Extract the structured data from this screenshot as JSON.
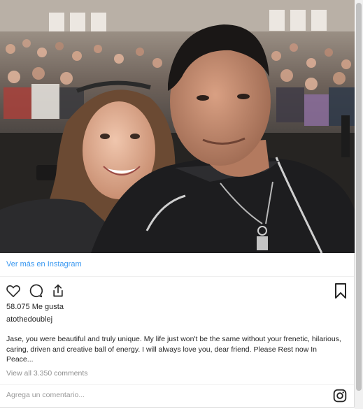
{
  "post": {
    "view_more_link": "Ver más en Instagram",
    "likes": "58.075 Me gusta",
    "username": "atothedoublej",
    "caption": "Jase, you were beautiful and truly unique. My life just won't be the same without your frenetic, hilarious, caring, driven and creative ball of energy. I will always love you, dear friend. Please Rest now In Peace...",
    "view_all_comments": "View all 3.350 comments",
    "comment_placeholder": "Agrega un comentario..."
  },
  "icons": {
    "like": "heart-icon",
    "comment": "comment-bubble-icon",
    "share": "share-icon",
    "save": "bookmark-icon",
    "brand": "instagram-icon"
  },
  "colors": {
    "link": "#3897f0",
    "text": "#262626",
    "muted": "#8e8e8e",
    "divider": "#efefef"
  }
}
